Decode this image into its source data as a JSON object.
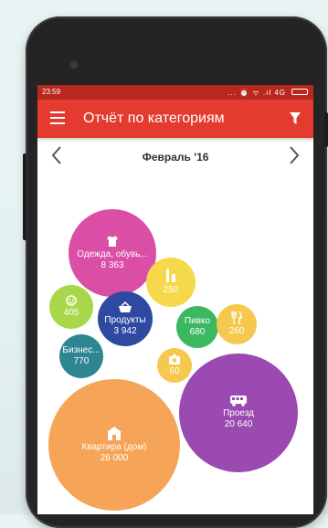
{
  "status_bar": {
    "time": "23:59",
    "icons": "... ⏰ ᯤ .ıl 4G"
  },
  "app_bar": {
    "title": "Отчёт по категориям"
  },
  "month_nav": {
    "label": "Февраль '16"
  },
  "colors": {
    "app_bar": "#e53a2f",
    "status_bar": "#b9281f",
    "clothing": "#da4ea6",
    "alcohol": "#f5d94a",
    "entertainment": "#a8d84a",
    "groceries": "#2e4aa0",
    "beer": "#3bb860",
    "restaurants": "#f6c84e",
    "business": "#2f8693",
    "cafe": "#f6c84e",
    "transport": "#9a4ab0",
    "apartment": "#f6a558"
  },
  "bubbles": [
    {
      "key": "clothing",
      "label": "Одежда, обувь,..",
      "value": "8 363",
      "icon": "shirt-icon"
    },
    {
      "key": "alcohol",
      "label": "",
      "value": "250",
      "icon": "bottle-icon"
    },
    {
      "key": "entertainment",
      "label": "",
      "value": "405",
      "icon": "smile-icon"
    },
    {
      "key": "groceries",
      "label": "Продукты",
      "value": "3 942",
      "icon": "basket-icon"
    },
    {
      "key": "beer",
      "label": "Пивко",
      "value": "680",
      "icon": ""
    },
    {
      "key": "restaurants",
      "label": "",
      "value": "260",
      "icon": "cutlery-icon"
    },
    {
      "key": "business",
      "label": "Бизнес...",
      "value": "770",
      "icon": ""
    },
    {
      "key": "cafe",
      "label": "",
      "value": "60",
      "icon": "camera-icon"
    },
    {
      "key": "transport",
      "label": "Проезд",
      "value": "20 640",
      "icon": "bus-icon"
    },
    {
      "key": "apartment",
      "label": "Квартира (дом)",
      "value": "26 000",
      "icon": "house-icon"
    }
  ]
}
